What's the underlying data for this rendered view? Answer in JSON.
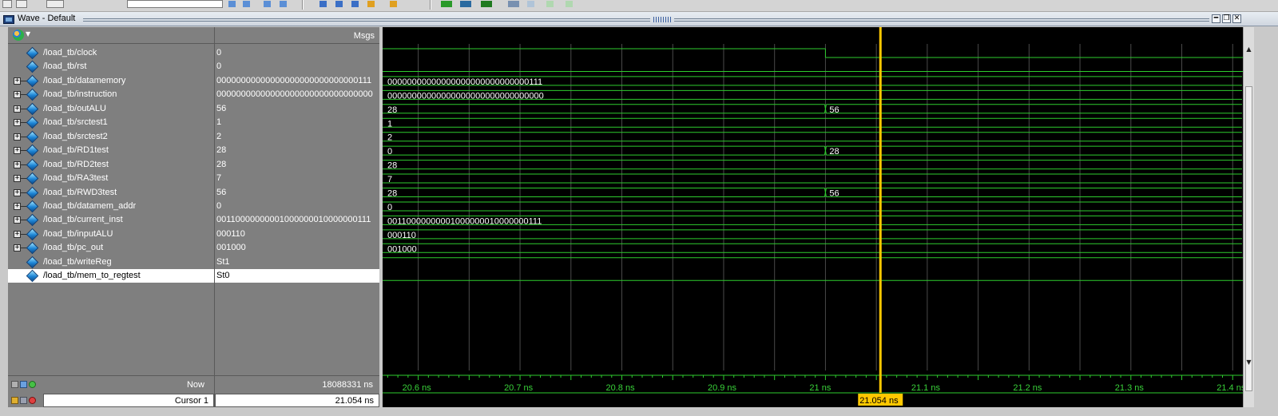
{
  "window": {
    "title": "Wave - Default",
    "controls": [
      "━",
      "❐",
      "✕"
    ]
  },
  "header": {
    "msgs_label": "Msgs"
  },
  "signals": [
    {
      "name": "/load_tb/clock",
      "value": "0",
      "expandable": false,
      "wave_type": "bit",
      "wave_label": ""
    },
    {
      "name": "/load_tb/rst",
      "value": "0",
      "expandable": false,
      "wave_type": "bit",
      "wave_label": ""
    },
    {
      "name": "/load_tb/datamemory",
      "value": "00000000000000000000000000000111",
      "expandable": true,
      "wave_type": "bus",
      "wave_label": "00000000000000000000000000000111"
    },
    {
      "name": "/load_tb/instruction",
      "value": "00000000000000000000000000000000",
      "expandable": true,
      "wave_type": "bus",
      "wave_label": "00000000000000000000000000000000"
    },
    {
      "name": "/load_tb/outALU",
      "value": "56",
      "expandable": true,
      "wave_type": "bus",
      "wave_label": "28",
      "change_at_ns": 21.0,
      "wave_label_after": "56"
    },
    {
      "name": "/load_tb/srctest1",
      "value": "1",
      "expandable": true,
      "wave_type": "bus",
      "wave_label": "1"
    },
    {
      "name": "/load_tb/srctest2",
      "value": "2",
      "expandable": true,
      "wave_type": "bus",
      "wave_label": "2"
    },
    {
      "name": "/load_tb/RD1test",
      "value": "28",
      "expandable": true,
      "wave_type": "bus",
      "wave_label": "0",
      "change_at_ns": 21.0,
      "wave_label_after": "28"
    },
    {
      "name": "/load_tb/RD2test",
      "value": "28",
      "expandable": true,
      "wave_type": "bus",
      "wave_label": "28"
    },
    {
      "name": "/load_tb/RA3test",
      "value": "7",
      "expandable": true,
      "wave_type": "bus",
      "wave_label": "7"
    },
    {
      "name": "/load_tb/RWD3test",
      "value": "56",
      "expandable": true,
      "wave_type": "bus",
      "wave_label": "28",
      "change_at_ns": 21.0,
      "wave_label_after": "56"
    },
    {
      "name": "/load_tb/datamem_addr",
      "value": "0",
      "expandable": true,
      "wave_type": "bus",
      "wave_label": "0"
    },
    {
      "name": "/load_tb/current_inst",
      "value": "00110000000001000000010000000111",
      "expandable": true,
      "wave_type": "bus",
      "wave_label": "00110000000001000000010000000111"
    },
    {
      "name": "/load_tb/inputALU",
      "value": "000110",
      "expandable": true,
      "wave_type": "bus",
      "wave_label": "000110"
    },
    {
      "name": "/load_tb/pc_out",
      "value": "001000",
      "expandable": true,
      "wave_type": "bus",
      "wave_label": "001000"
    },
    {
      "name": "/load_tb/writeReg",
      "value": "St1",
      "expandable": false,
      "wave_type": "bit",
      "wave_label": ""
    },
    {
      "name": "/load_tb/mem_to_regtest",
      "value": "St0",
      "expandable": false,
      "wave_type": "bit",
      "wave_label": "",
      "selected": true
    }
  ],
  "waveform": {
    "time_start_ns": 20.565,
    "time_end_ns": 21.41,
    "clock": {
      "level_before": 1,
      "fall_at_ns": 21.0,
      "level_after": 0
    },
    "rst_level": 0,
    "writeReg_level": 1,
    "mem_to_regtest_level": 0,
    "grid_ns": [
      20.6,
      20.65,
      20.7,
      20.75,
      20.8,
      20.85,
      20.9,
      20.95,
      21.0,
      21.05,
      21.1,
      21.15,
      21.2,
      21.25,
      21.3,
      21.35,
      21.4
    ],
    "tick_labels": [
      {
        "ns": 20.6,
        "label": "20.6 ns"
      },
      {
        "ns": 20.7,
        "label": "20.7 ns"
      },
      {
        "ns": 20.8,
        "label": "20.8 ns"
      },
      {
        "ns": 20.9,
        "label": "20.9 ns"
      },
      {
        "ns": 21.0,
        "label": "21 ns"
      },
      {
        "ns": 21.1,
        "label": "21.1 ns"
      },
      {
        "ns": 21.2,
        "label": "21.2 ns"
      },
      {
        "ns": 21.3,
        "label": "21.3 ns"
      },
      {
        "ns": 21.4,
        "label": "21.4 ns"
      }
    ],
    "cursor_ns": 21.054,
    "cursor_label": "21.054 ns",
    "wave_color": "#2ecc2e",
    "cursor_color": "#ffc800",
    "grid_color": "#4a4a4a"
  },
  "footer": {
    "now_label": "Now",
    "now_value": "18088331 ns",
    "cursor_name": "Cursor 1",
    "cursor_value": "21.054 ns"
  }
}
